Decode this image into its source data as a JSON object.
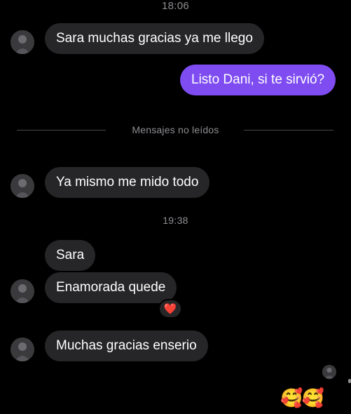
{
  "thread": {
    "timestamp_top": "18:06",
    "timestamp_mid": "19:38",
    "unread_label": "Mensajes no leídos",
    "messages": [
      {
        "text": "Sara muchas gracias ya me llego",
        "from": "them"
      },
      {
        "text": "Listo Dani, si te sirvió?",
        "from": "me"
      },
      {
        "text": "Ya mismo me mido todo",
        "from": "them"
      },
      {
        "text": "Sara",
        "from": "them"
      },
      {
        "text": "Enamorada quede",
        "from": "them",
        "reaction": "❤️"
      },
      {
        "text": "Muchas gracias enserio",
        "from": "them"
      }
    ]
  },
  "composer": {
    "emojis": "🥰🥰"
  },
  "colors": {
    "background": "#000000",
    "received_bubble": "#262628",
    "sent_bubble": "#7e4cf1",
    "meta_text": "#8e8e93"
  }
}
